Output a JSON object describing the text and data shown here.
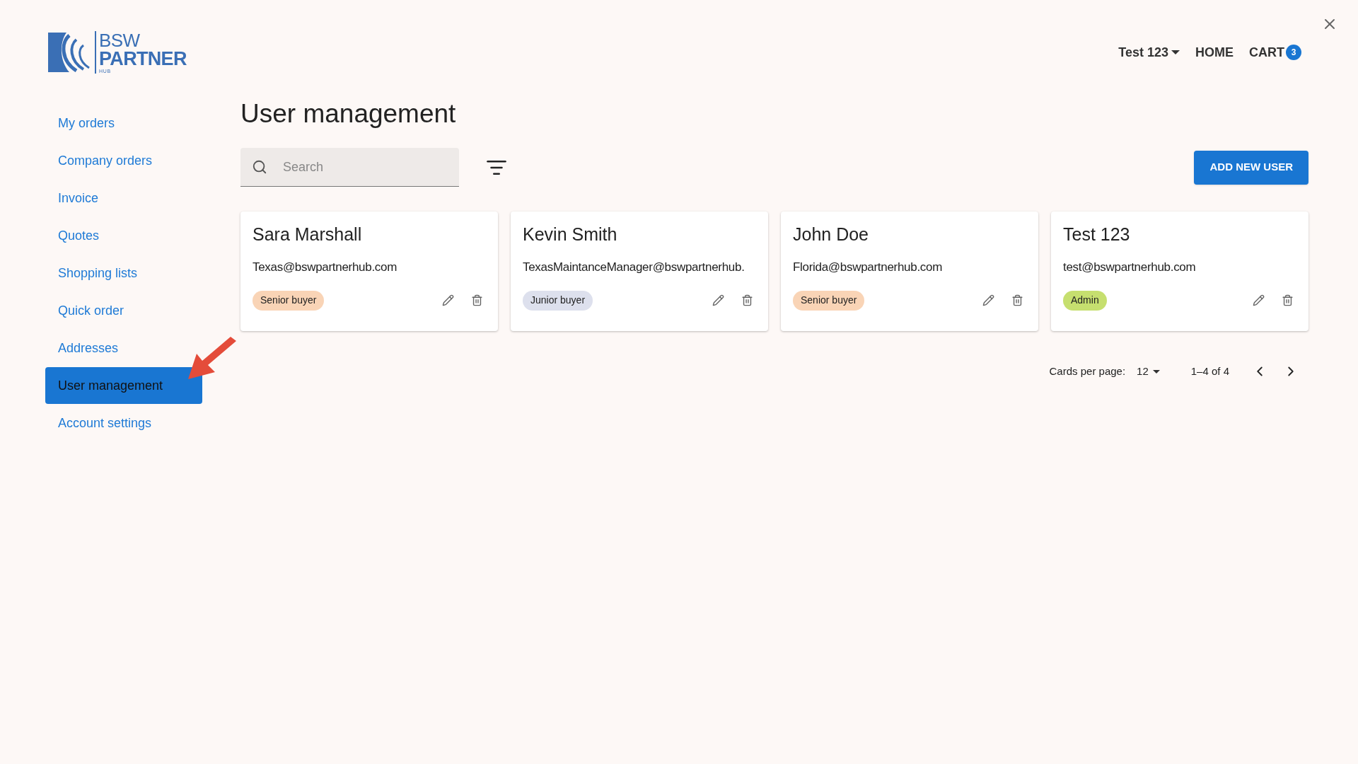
{
  "logo": {
    "line1": "BSW",
    "line2": "PARTNER",
    "line3": "HUB"
  },
  "header": {
    "account": "Test 123",
    "links": [
      "HOME",
      "CART"
    ],
    "cart_count": "3"
  },
  "sidebar": {
    "items": [
      {
        "label": "My orders",
        "selected": false
      },
      {
        "label": "Company orders",
        "selected": false
      },
      {
        "label": "Invoice",
        "selected": false
      },
      {
        "label": "Quotes",
        "selected": false
      },
      {
        "label": "Shopping lists",
        "selected": false
      },
      {
        "label": "Quick order",
        "selected": false
      },
      {
        "label": "Addresses",
        "selected": false
      },
      {
        "label": "User management",
        "selected": true
      },
      {
        "label": "Account settings",
        "selected": false
      }
    ]
  },
  "page": {
    "title": "User management",
    "search": {
      "placeholder": "Search"
    },
    "add_button": "ADD NEW USER"
  },
  "users": [
    {
      "name": "Sara Marshall",
      "email": "Texas@bswpartnerhub.com",
      "role": "Senior buyer",
      "color": "#f9d4b6"
    },
    {
      "name": "Kevin Smith",
      "email": "TexasMaintanceManager@bswpartnerhub.",
      "role": "Junior buyer",
      "color": "#dde0ed"
    },
    {
      "name": "John Doe",
      "email": "Florida@bswpartnerhub.com",
      "role": "Senior buyer",
      "color": "#f9d4b6"
    },
    {
      "name": "Test 123",
      "email": "test@bswpartnerhub.com",
      "role": "Admin",
      "color": "#c6df6f"
    }
  ],
  "pagination": {
    "label": "Cards per page:",
    "per_page": "12",
    "range": "1–4 of 4"
  }
}
